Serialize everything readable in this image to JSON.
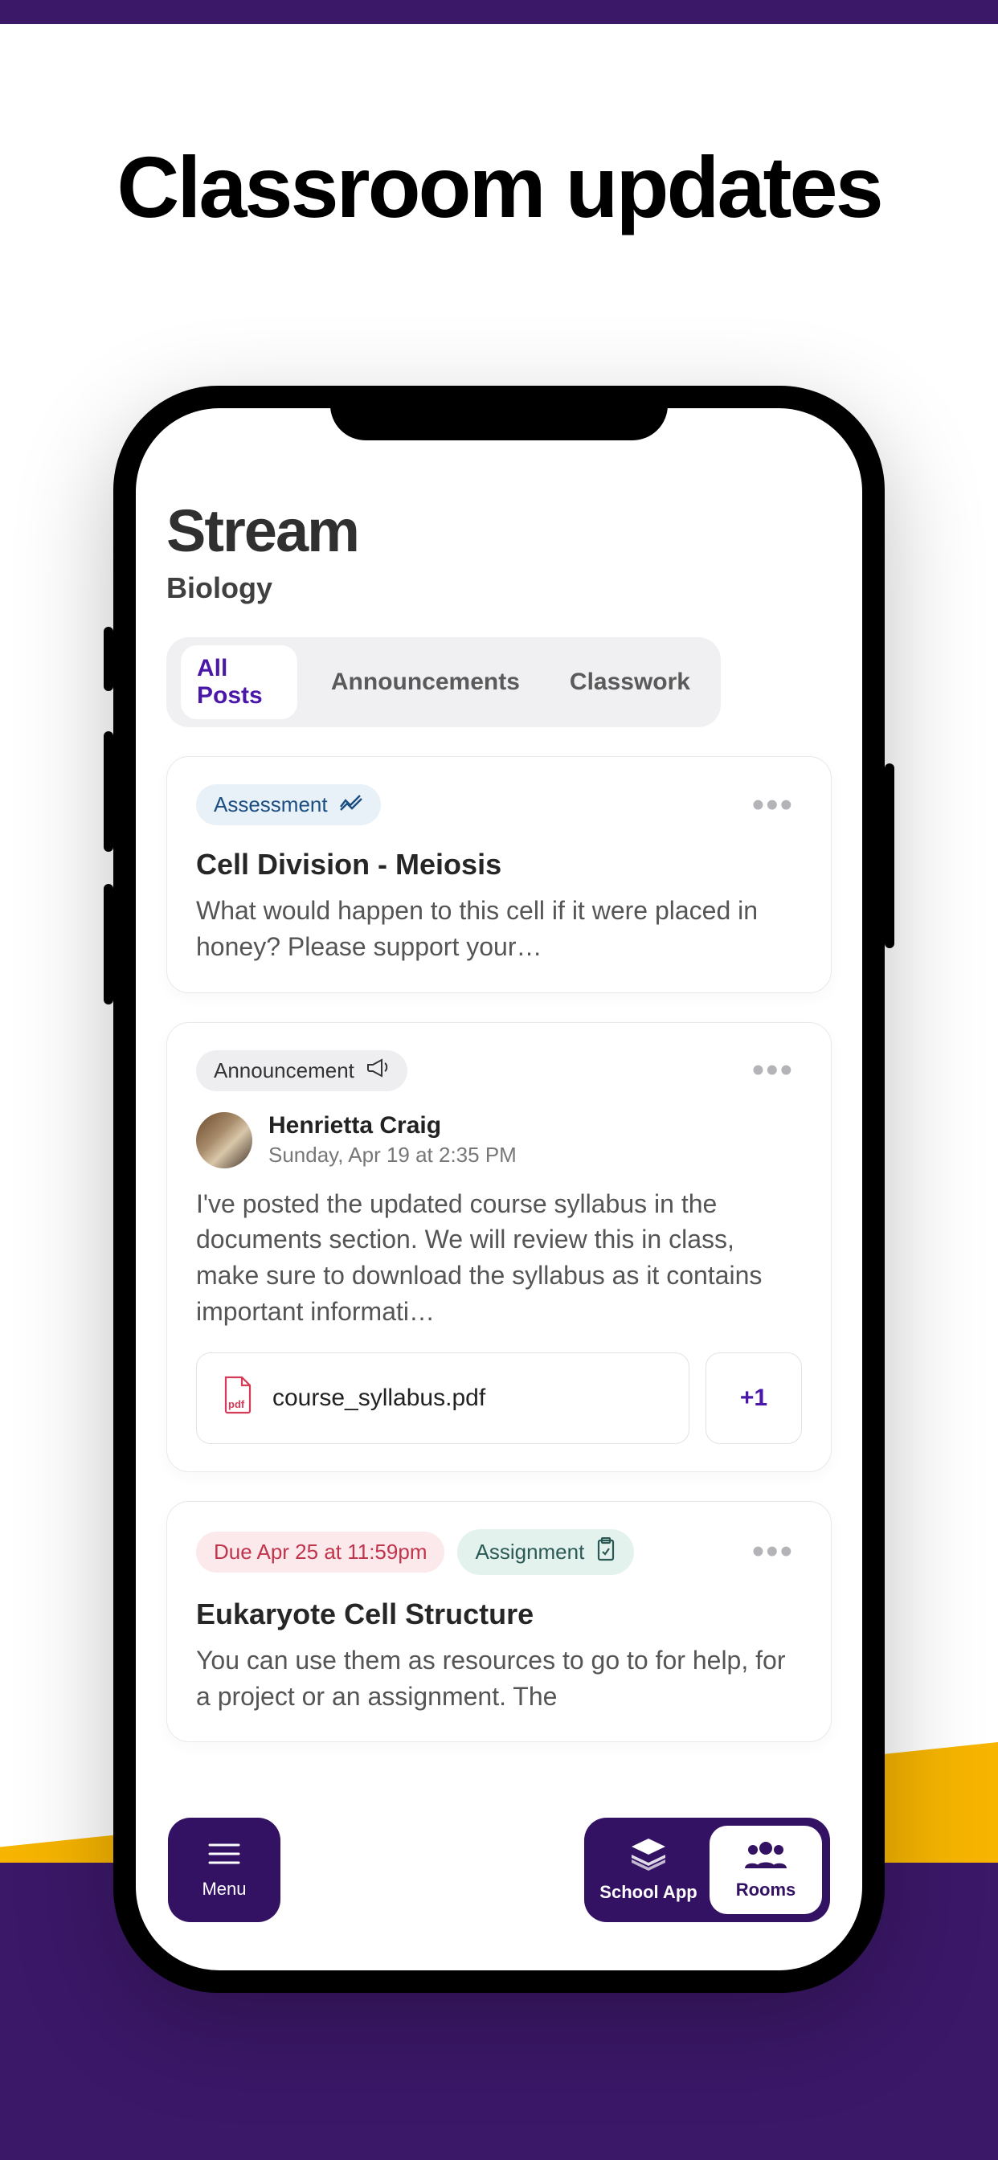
{
  "hero": {
    "title": "Classroom updates"
  },
  "header": {
    "title": "Stream",
    "subtitle": "Biology"
  },
  "tabs": [
    {
      "label": "All Posts",
      "active": true
    },
    {
      "label": "Announcements",
      "active": false
    },
    {
      "label": "Classwork",
      "active": false
    }
  ],
  "posts": [
    {
      "badge": {
        "label": "Assessment",
        "style": "blue",
        "icon": "trend"
      },
      "title": "Cell Division - Meiosis",
      "body": "What would happen to this cell if it were placed in honey? Please support your…"
    },
    {
      "badge": {
        "label": "Announcement",
        "style": "gray",
        "icon": "megaphone"
      },
      "author": {
        "name": "Henrietta Craig",
        "date": "Sunday, Apr 19 at 2:35 PM"
      },
      "body": "I've posted the updated course syllabus in the documents section. We will review this in class, make sure to download the syllabus as it contains important informati…",
      "attachment": {
        "filename": "course_syllabus.pdf",
        "extra": "+1"
      }
    },
    {
      "due": {
        "text": "Due Apr 25 at 11:59pm"
      },
      "badge": {
        "label": "Assignment",
        "style": "teal",
        "icon": "clipboard"
      },
      "title": "Eukaryote Cell Structure",
      "body": "You can use them as resources to go to for help, for a project or an assignment. The"
    }
  ],
  "fab": {
    "menu": "Menu",
    "schoolApp": "School App",
    "rooms": "Rooms"
  }
}
